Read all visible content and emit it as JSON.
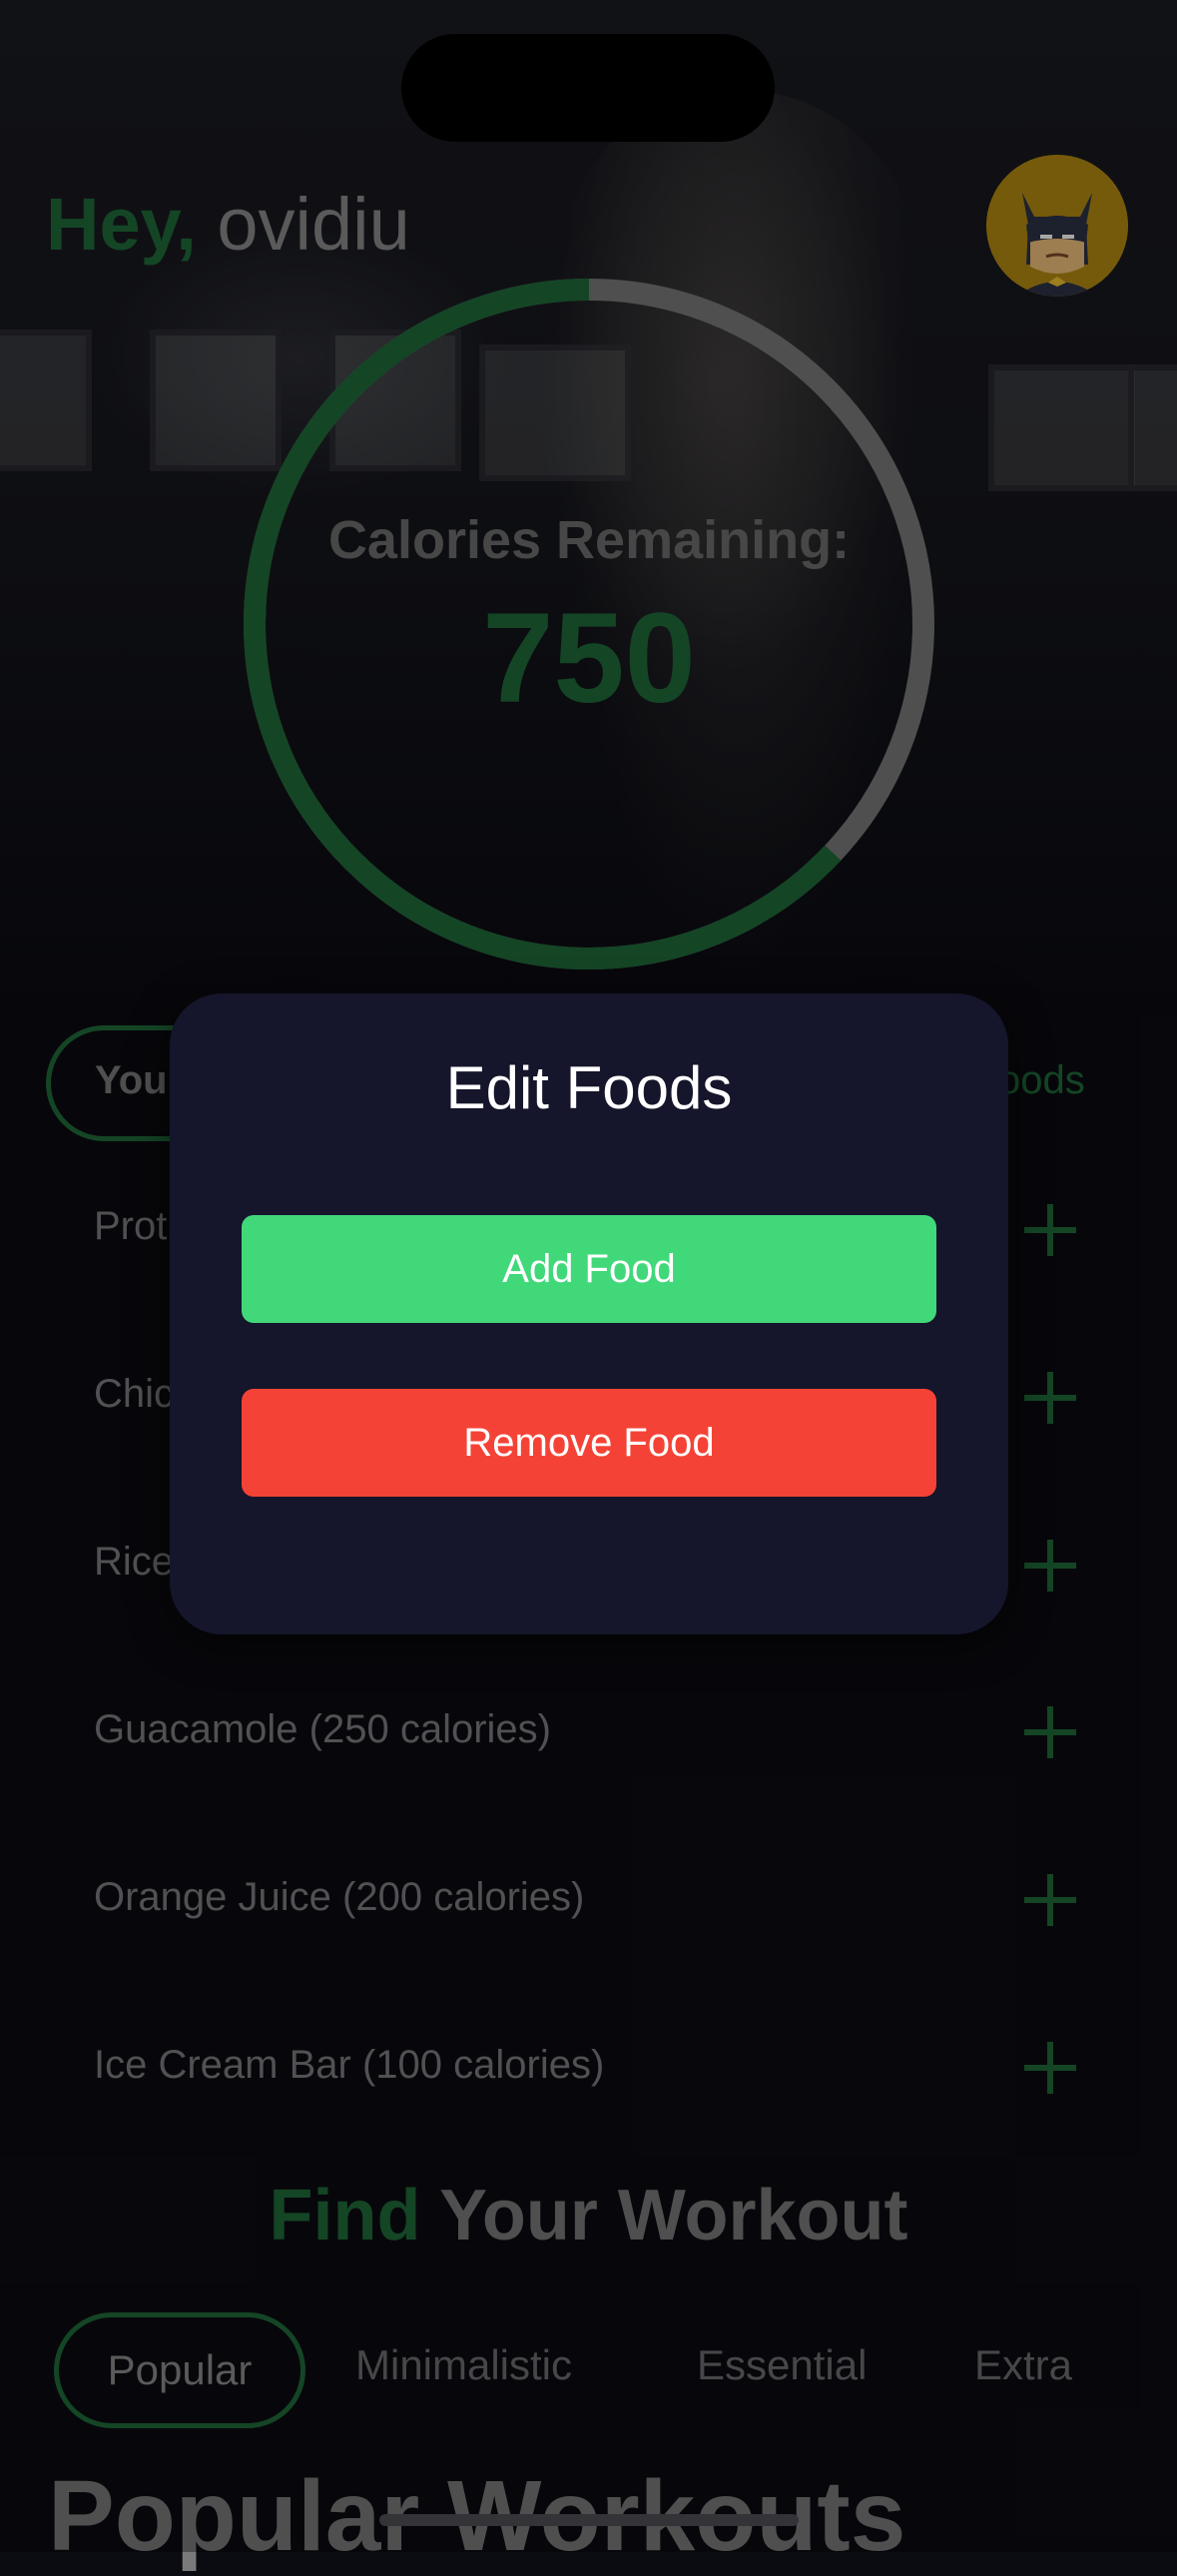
{
  "header": {
    "greeting_prefix": "Hey,",
    "username": "ovidiu",
    "avatar_icon": "batman-avatar-icon"
  },
  "calories": {
    "label": "Calories Remaining:",
    "value": "750",
    "progress_fraction": 0.63,
    "accent_color": "#1f6b3a",
    "track_color": "#7a7a7a"
  },
  "foods_section": {
    "tab_label": "You",
    "right_link": "oods",
    "items": [
      {
        "label": "Prot",
        "action_icon": "plus-icon"
      },
      {
        "label": "Chic",
        "action_icon": "plus-icon"
      },
      {
        "label": "Rice",
        "action_icon": "plus-icon"
      },
      {
        "label": "Guacamole (250 calories)",
        "action_icon": "plus-icon"
      },
      {
        "label": "Orange Juice (200 calories)",
        "action_icon": "plus-icon"
      },
      {
        "label": "Ice Cream Bar (100 calories)",
        "action_icon": "plus-icon"
      }
    ]
  },
  "workout": {
    "title_accent": "Find",
    "title_rest": "Your Workout",
    "categories": [
      "Popular",
      "Minimalistic",
      "Essential",
      "Extra"
    ],
    "active_category": "Popular",
    "section_heading": "Popular Workouts"
  },
  "modal": {
    "title": "Edit Foods",
    "add_label": "Add Food",
    "remove_label": "Remove Food",
    "add_color": "#41d87a",
    "remove_color": "#f44336",
    "background": "#15152b"
  }
}
